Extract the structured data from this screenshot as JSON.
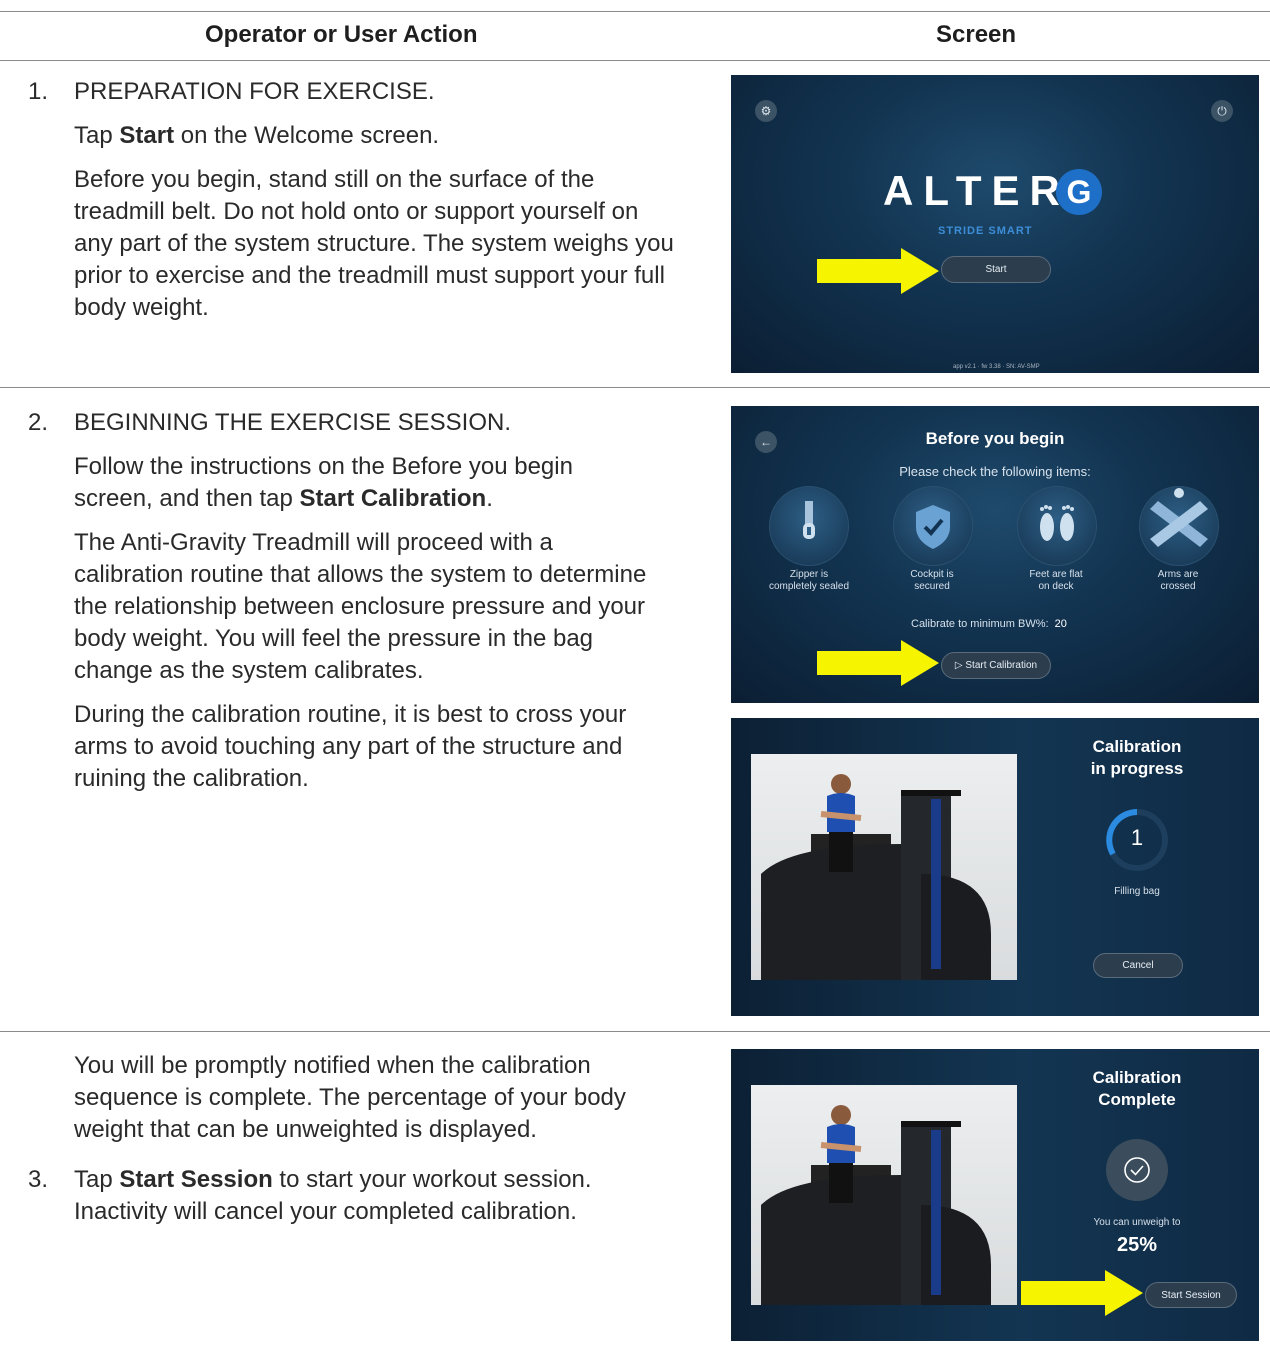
{
  "header": {
    "col_left": "Operator or User Action",
    "col_right": "Screen"
  },
  "steps": [
    {
      "num": "1.",
      "title": "PREPARATION FOR EXERCISE.",
      "p1_pre": "Tap ",
      "p1_bold": "Start",
      "p1_post": " on the Welcome screen.",
      "p2": "Before you begin, stand still on the surface of the treadmill belt. Do not hold onto or support yourself on any part of the system structure. The system weighs you prior to exercise and the treadmill must support your full body weight."
    },
    {
      "num": "2.",
      "title": "BEGINNING THE EXERCISE SESSION.",
      "p1_pre": "Follow the instructions on the Before you begin screen, and then tap ",
      "p1_bold": "Start Calibration",
      "p1_post": ".",
      "p2": "The Anti-Gravity Treadmill will proceed with a calibration routine that allows the system to determine the relationship between enclosure pressure and your body weight. You will feel the pressure in the bag change as the system calibrates.",
      "p3": "During the calibration routine, it is best to cross your arms to avoid touching any part of the structure and ruining the calibration."
    },
    {
      "intro": "You will be promptly notified when the calibration sequence is complete. The percentage of your body weight that can be unweighted is displayed.",
      "num": "3.",
      "p1_pre": "Tap ",
      "p1_bold": "Start Session",
      "p1_post": " to start your workout session. Inactivity will cancel your completed calibration."
    }
  ],
  "screens": {
    "welcome": {
      "logo_text": "ALTER",
      "logo_g": "G",
      "subtitle": "STRIDE SMART",
      "start_label": "Start",
      "footer": "app v2.1 · fw 3.38 · SN: AV-SMP"
    },
    "before": {
      "title": "Before you begin",
      "subtitle": "Please check the following items:",
      "items": [
        {
          "l1": "Zipper is",
          "l2": "completely sealed"
        },
        {
          "l1": "Cockpit is",
          "l2": "secured"
        },
        {
          "l1": "Feet are flat",
          "l2": "on deck"
        },
        {
          "l1": "Arms are",
          "l2": "crossed"
        }
      ],
      "calibrate_label": "Calibrate to minimum BW%:",
      "calibrate_value": "20",
      "start_calibration": "Start Calibration"
    },
    "progress": {
      "title1": "Calibration",
      "title2": "in progress",
      "counter": "1",
      "status": "Filling bag",
      "cancel": "Cancel"
    },
    "complete": {
      "title1": "Calibration",
      "title2": "Complete",
      "unweigh_label": "You can unweigh to",
      "unweigh_value": "25%",
      "start_session": "Start Session"
    }
  },
  "colors": {
    "arrow": "#f7f400",
    "screen_bg": "#10304c"
  }
}
